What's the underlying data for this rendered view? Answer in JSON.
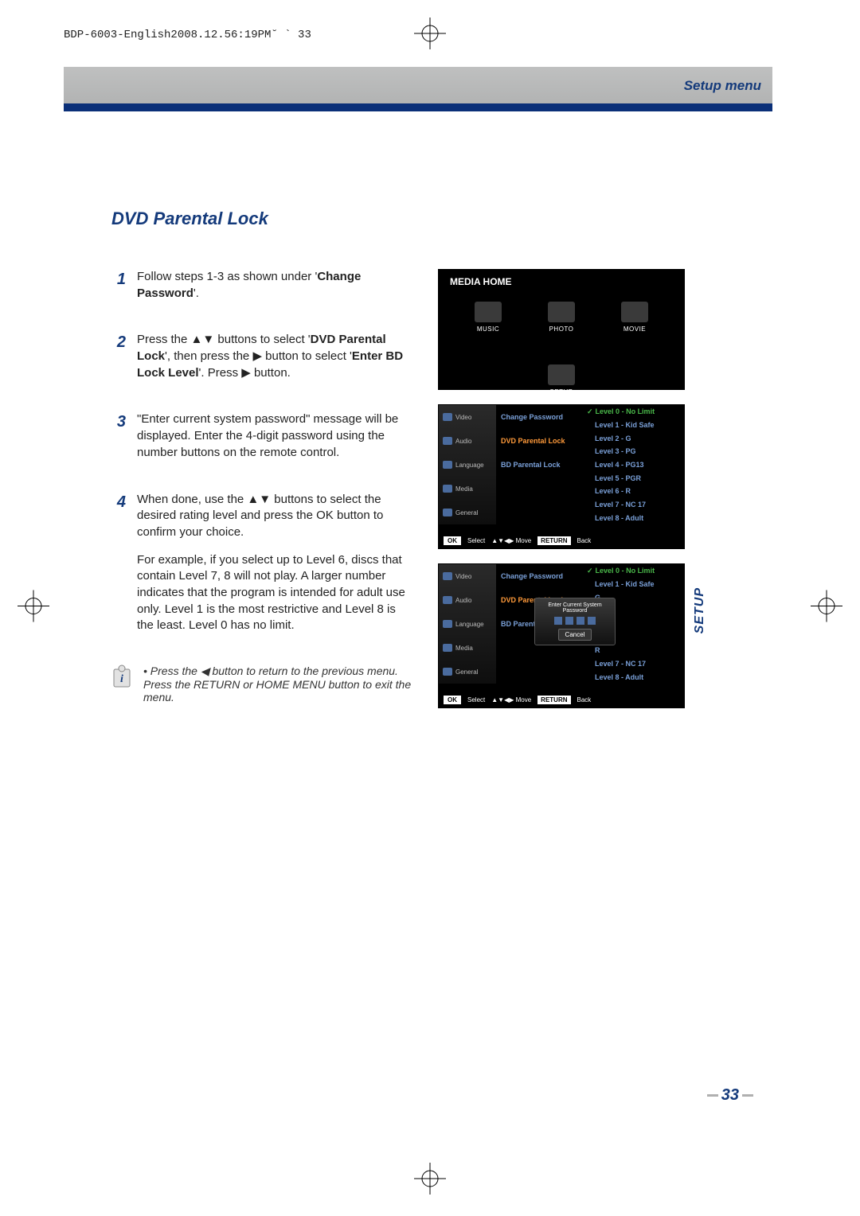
{
  "header_stamp": "BDP-6003-English2008.12.56:19PM˘ ` 33",
  "chapter_label": "Setup menu",
  "side_tab": "SETUP",
  "section_title": "DVD Parental Lock",
  "page_number": "33",
  "steps": [
    {
      "n": "1",
      "pre": "Follow steps 1-3 as shown under '",
      "b": "Change Password",
      "post": "'."
    },
    {
      "n": "2",
      "pre": "Press the ▲▼ buttons to select '",
      "b": "DVD Parental Lock",
      "post": "', then press the ▶ button to select '",
      "b2": "Enter BD Lock Level",
      "post2": "'. Press ▶ button."
    },
    {
      "n": "3",
      "pre": "\"Enter current system password\" message will be displayed. Enter the 4-digit password using the number buttons on the remote control.",
      "b": "",
      "post": ""
    },
    {
      "n": "4",
      "pre": "When done, use the ▲▼ buttons to select the desired rating level and press the OK button to confirm your choice.",
      "b": "",
      "post": "",
      "extra": "For example, if you select up to Level 6, discs that contain Level 7, 8 will not play. A larger number indicates that the program is intended for adult use only. Level 1 is the most restrictive and Level 8 is the least. Level 0 has no limit."
    }
  ],
  "note_text": "• Press the ◀ button to return to the previous menu. Press the RETURN or HOME MENU button to exit the menu.",
  "media_home": {
    "title": "MEDIA HOME",
    "items": [
      "MUSIC",
      "PHOTO",
      "MOVIE",
      "SETUP"
    ]
  },
  "setup_sidebar": [
    "Video",
    "Audio",
    "Language",
    "Media",
    "General"
  ],
  "setup_mid": [
    {
      "label": "Change Password",
      "sel": false
    },
    {
      "label": "DVD Parental Lock",
      "sel": true
    },
    {
      "label": "BD Parental Lock",
      "sel": false
    }
  ],
  "levels": [
    "Level 0 - No Limit",
    "Level 1 - Kid Safe",
    "Level 2 - G",
    "Level 3 - PG",
    "Level 4 - PG13",
    "Level 5 - PGR",
    "Level 6 - R",
    "Level 7 - NC 17",
    "Level 8 - Adult"
  ],
  "levels_short": [
    "Level 0 - No Limit",
    "Level 1 - Kid Safe",
    "G",
    "PG",
    "PG13",
    "PGR",
    "R",
    "Level 7 - NC 17",
    "Level 8 - Adult"
  ],
  "bottombar": {
    "ok": "OK",
    "select": "Select",
    "move": "▲▼◀▶ Move",
    "return": "RETURN",
    "back": "Back"
  },
  "dialog": {
    "title": "Enter Current System Password",
    "cancel": "Cancel"
  }
}
